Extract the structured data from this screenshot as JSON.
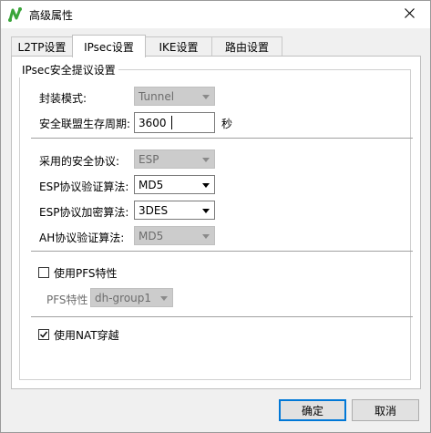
{
  "window": {
    "title": "高级属性"
  },
  "tabs": [
    {
      "label": "L2TP设置",
      "active": false
    },
    {
      "label": "IPsec设置",
      "active": true
    },
    {
      "label": "IKE设置",
      "active": false
    },
    {
      "label": "路由设置",
      "active": false
    }
  ],
  "group": {
    "title": "IPsec安全提议设置"
  },
  "fields": {
    "encapsulation": {
      "label": "封装模式:",
      "value": "Tunnel",
      "enabled": false
    },
    "sa_lifetime": {
      "label": "安全联盟生存周期:",
      "value": "3600",
      "unit": "秒"
    },
    "protocol": {
      "label": "采用的安全协议:",
      "value": "ESP",
      "enabled": false
    },
    "esp_auth": {
      "label": "ESP协议验证算法:",
      "value": "MD5",
      "enabled": true
    },
    "esp_enc": {
      "label": "ESP协议加密算法:",
      "value": "3DES",
      "enabled": true
    },
    "ah_auth": {
      "label": "AH协议验证算法:",
      "value": "MD5",
      "enabled": false
    },
    "use_pfs": {
      "label": "使用PFS特性",
      "checked": false
    },
    "pfs": {
      "label": "PFS特性",
      "value": "dh-group1",
      "enabled": false
    },
    "use_nat": {
      "label": "使用NAT穿越",
      "checked": true
    }
  },
  "buttons": {
    "ok": "确定",
    "cancel": "取消"
  },
  "colors": {
    "accent": "#0078d7",
    "icon_green": "#3aa53a"
  }
}
